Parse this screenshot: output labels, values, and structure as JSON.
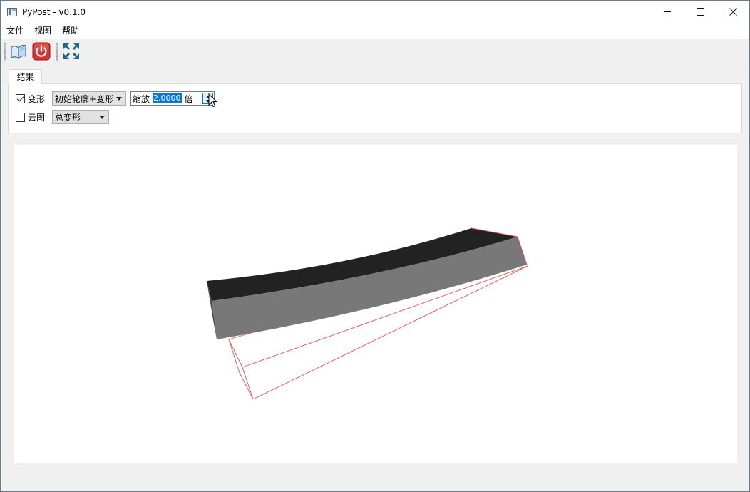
{
  "window": {
    "title": "PyPost - v0.1.0",
    "controls": {
      "minimize": "minimize-icon",
      "maximize": "maximize-icon",
      "close": "close-icon"
    }
  },
  "menu": {
    "items": [
      {
        "label": "文件"
      },
      {
        "label": "视图"
      },
      {
        "label": "帮助"
      }
    ]
  },
  "toolbar": {
    "buttons": [
      {
        "icon": "open-book-icon"
      },
      {
        "icon": "power-icon"
      },
      {
        "icon": "fit-view-icon"
      }
    ]
  },
  "tabs": [
    {
      "label": "结果",
      "active": true
    }
  ],
  "result_panel": {
    "deform": {
      "checkbox_label": "变形",
      "checked": true,
      "mode_selected": "初始轮廓+变形",
      "scale_prefix": "缩放",
      "scale_value": "2.0000",
      "scale_suffix": "倍"
    },
    "contour": {
      "checkbox_label": "云图",
      "checked": false,
      "type_selected": "总变形"
    }
  },
  "colors": {
    "beam_top": "#222222",
    "beam_side": "#787878",
    "outline": "#e05050",
    "accent": "#0078d7"
  }
}
